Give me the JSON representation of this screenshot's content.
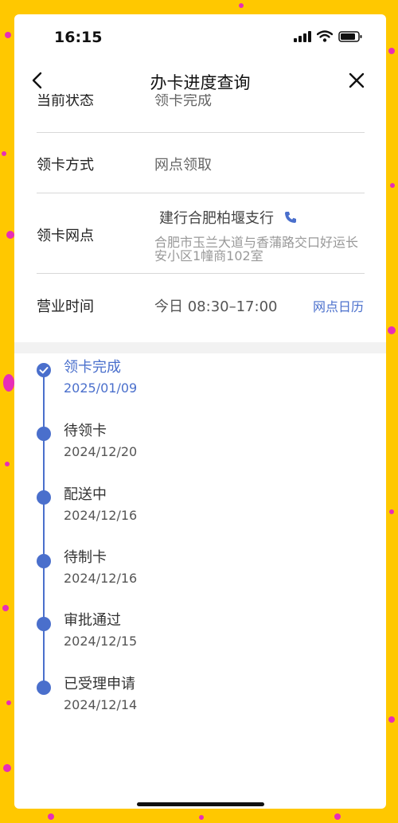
{
  "status_bar": {
    "time": "16:15"
  },
  "nav": {
    "title": "办卡进度查询"
  },
  "details": {
    "current_status_label": "当前状态",
    "current_status_value": "领卡完成",
    "method_label": "领卡方式",
    "method_value": "网点领取",
    "branch_label": "领卡网点",
    "branch_name": "建行合肥柏堰支行",
    "branch_address": "合肥市玉兰大道与香蒲路交口好运长安小区1幢商102室",
    "hours_label": "营业时间",
    "hours_value": "今日 08:30–17:00",
    "calendar_link": "网点日历"
  },
  "timeline": [
    {
      "status": "领卡完成",
      "date": "2025/01/09",
      "current": true
    },
    {
      "status": "待领卡",
      "date": "2024/12/20",
      "current": false
    },
    {
      "status": "配送中",
      "date": "2024/12/16",
      "current": false
    },
    {
      "status": "待制卡",
      "date": "2024/12/16",
      "current": false
    },
    {
      "status": "审批通过",
      "date": "2024/12/15",
      "current": false
    },
    {
      "status": "已受理申请",
      "date": "2024/12/14",
      "current": false
    }
  ],
  "colors": {
    "accent": "#4A6FCC",
    "background": "#FFC800",
    "dots": "#E72DB8"
  }
}
